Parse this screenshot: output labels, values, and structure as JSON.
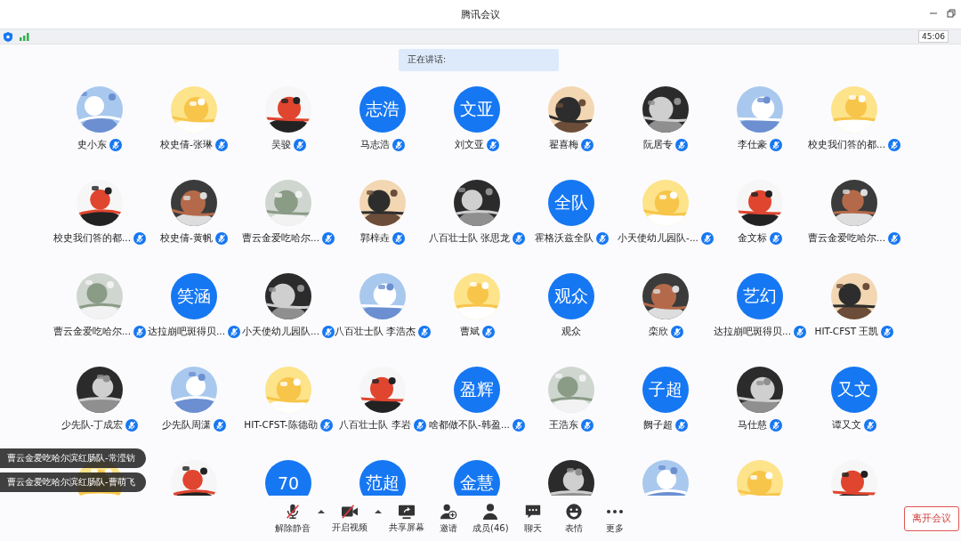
{
  "window": {
    "title": "腾讯会议"
  },
  "status_bar": {
    "timer": "45:06"
  },
  "speaking": {
    "label": "正在讲话:"
  },
  "members": [
    {
      "kind": "picture",
      "name": "史小东",
      "muted": true
    },
    {
      "kind": "picture",
      "name": "校史倩-张琳",
      "muted": true
    },
    {
      "kind": "picture",
      "name": "吴骏",
      "muted": true
    },
    {
      "kind": "initials",
      "initials": "志浩",
      "name": "马志浩",
      "muted": true
    },
    {
      "kind": "initials",
      "initials": "文亚",
      "name": "刘文亚",
      "muted": true
    },
    {
      "kind": "picture",
      "name": "翟喜梅",
      "muted": true
    },
    {
      "kind": "picture",
      "name": "阮居专",
      "muted": true
    },
    {
      "kind": "picture",
      "name": "李仕豪",
      "muted": true
    },
    {
      "kind": "picture",
      "name": "校史我们答的都...",
      "muted": true
    },
    {
      "kind": "picture",
      "name": "校史我们答的都...",
      "muted": true
    },
    {
      "kind": "picture",
      "name": "校史倩-黄帆",
      "muted": true
    },
    {
      "kind": "picture",
      "name": "曹云金爱吃哈尔...",
      "muted": true
    },
    {
      "kind": "picture",
      "name": "郭梓垚",
      "muted": true
    },
    {
      "kind": "picture",
      "name": "八百壮士队 张思龙",
      "muted": true
    },
    {
      "kind": "initials",
      "initials": "全队",
      "name": "霍格沃兹全队",
      "muted": true
    },
    {
      "kind": "picture",
      "name": "小天使幼儿园队-...",
      "muted": true
    },
    {
      "kind": "picture",
      "name": "金文标",
      "muted": true
    },
    {
      "kind": "picture",
      "name": "曹云金爱吃哈尔...",
      "muted": true
    },
    {
      "kind": "picture",
      "name": "曹云金爱吃哈尔...",
      "muted": true
    },
    {
      "kind": "initials",
      "initials": "笑涵",
      "name": "达拉崩吧斑得贝...",
      "muted": true
    },
    {
      "kind": "picture",
      "name": "小天使幼儿园队...",
      "muted": true
    },
    {
      "kind": "picture",
      "name": "八百壮士队 李浩杰",
      "muted": true
    },
    {
      "kind": "picture",
      "name": "曹斌",
      "muted": true
    },
    {
      "kind": "initials",
      "initials": "观众",
      "name": "观众",
      "muted": false
    },
    {
      "kind": "picture",
      "name": "栾欣",
      "muted": true
    },
    {
      "kind": "initials",
      "initials": "艺幻",
      "name": "达拉崩吧斑得贝...",
      "muted": true
    },
    {
      "kind": "picture",
      "name": "HIT-CFST 王凯",
      "muted": true
    },
    {
      "kind": "picture",
      "name": "少先队-丁成宏",
      "muted": true
    },
    {
      "kind": "picture",
      "name": "少先队周潇",
      "muted": true
    },
    {
      "kind": "picture",
      "name": "HIT-CFST-陈德劭",
      "muted": true
    },
    {
      "kind": "picture",
      "name": "八百壮士队 李岩",
      "muted": true
    },
    {
      "kind": "initials",
      "initials": "盈辉",
      "name": "啥都做不队-韩盈...",
      "muted": true
    },
    {
      "kind": "picture",
      "name": "王浩东",
      "muted": true
    },
    {
      "kind": "initials",
      "initials": "子超",
      "name": "阙子超",
      "muted": true
    },
    {
      "kind": "picture",
      "name": "马仕慈",
      "muted": true
    },
    {
      "kind": "initials",
      "initials": "又文",
      "name": "谭又文",
      "muted": true
    },
    {
      "kind": "picture"
    },
    {
      "kind": "picture"
    },
    {
      "kind": "initials",
      "initials": "70"
    },
    {
      "kind": "initials",
      "initials": "范超"
    },
    {
      "kind": "initials",
      "initials": "金慧"
    },
    {
      "kind": "picture"
    },
    {
      "kind": "picture"
    },
    {
      "kind": "picture"
    },
    {
      "kind": "picture"
    }
  ],
  "notifications": [
    "曹云金爱吃哈尔滨红肠队-常滢钫",
    "曹云金爱吃哈尔滨红肠队-曹萌飞"
  ],
  "toolbar": [
    {
      "kind": "mic",
      "label": "解除静音",
      "menu": true
    },
    {
      "kind": "camera",
      "label": "开启视频",
      "menu": true
    },
    {
      "kind": "share",
      "label": "共享屏幕",
      "menu": false
    },
    {
      "kind": "invite",
      "label": "邀请",
      "menu": false
    },
    {
      "kind": "members",
      "label": "成员(46)",
      "menu": false
    },
    {
      "kind": "chat",
      "label": "聊天",
      "menu": false
    },
    {
      "kind": "emoji",
      "label": "表情",
      "menu": false
    },
    {
      "kind": "more",
      "label": "更多",
      "menu": false
    }
  ],
  "leave_button": "离开会议"
}
